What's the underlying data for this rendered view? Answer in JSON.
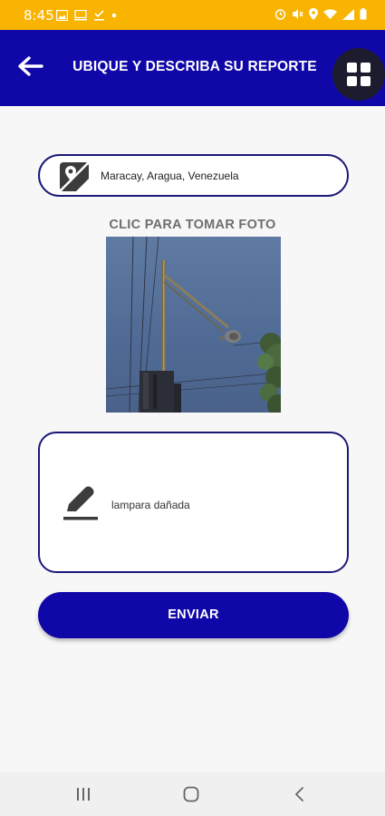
{
  "status_bar": {
    "time": "8:45",
    "background": "#f8b400",
    "left_icons": [
      "image-icon",
      "monitor-icon",
      "download-done-icon",
      "dot-icon"
    ],
    "right_icons": [
      "alarm-icon",
      "mute-icon",
      "location-icon",
      "wifi-icon",
      "signal-icon",
      "battery-icon"
    ]
  },
  "header": {
    "title": "UBIQUE Y DESCRIBA SU REPORTE",
    "background": "#1007a8",
    "back_icon": "arrow-left-icon",
    "menu_icon": "grid-icon"
  },
  "location": {
    "icon": "map-location-icon",
    "value": "Maracay, Aragua, Venezuela"
  },
  "photo": {
    "label": "CLIC PARA TOMAR FOTO",
    "subject": "street lamp pole against sky"
  },
  "description": {
    "icon": "pencil-icon",
    "value": "lampara dañada"
  },
  "submit": {
    "label": "ENVIAR",
    "background": "#1007a8"
  },
  "nav_bar": {
    "icons": [
      "recents-icon",
      "home-icon",
      "back-nav-icon"
    ]
  }
}
